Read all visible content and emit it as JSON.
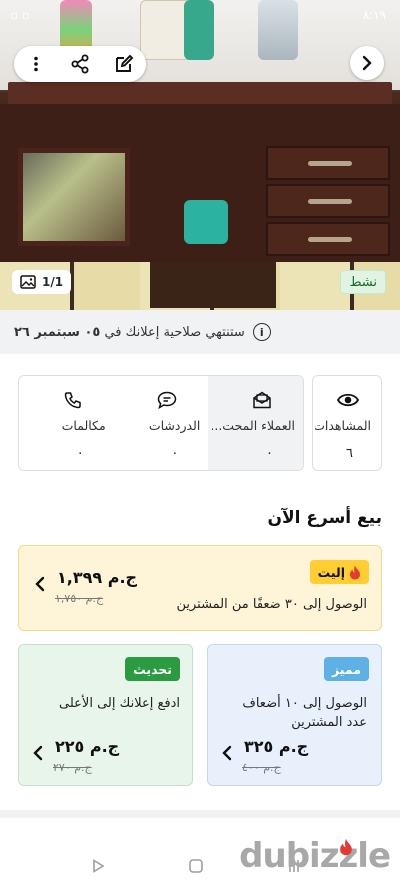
{
  "status_bar": {
    "time": "٨:١٩",
    "left_indicators": "▫ ▫"
  },
  "photo": {
    "counter": "1/1",
    "status_label": "نشط",
    "icons": {
      "back": "chevron-right-icon",
      "share": "share-icon",
      "edit": "edit-icon",
      "more": "more-vertical-icon",
      "gallery": "image-icon"
    }
  },
  "expiry": {
    "prefix": "ستنتهي صلاحية إعلانك في",
    "date": "٠٥ سبتمبر ٢٦",
    "icon": "info-icon"
  },
  "stats": {
    "views": {
      "label": "المشاهدات",
      "value": "٦",
      "icon": "eye-icon"
    },
    "leads": {
      "label": "العملاء المحت...",
      "value": "٠",
      "icon": "mail-open-icon"
    },
    "chats": {
      "label": "الدردشات",
      "value": "٠",
      "icon": "chat-icon"
    },
    "calls": {
      "label": "مكالمات",
      "value": "٠",
      "icon": "phone-icon"
    }
  },
  "sell_faster": {
    "title": "بيع أسرع الآن"
  },
  "elite": {
    "badge": "إليت",
    "badge_icon": "flame-icon",
    "description": "الوصول إلى ٣٠ ضعفًا من المشترين",
    "price": "ج.م ١,٣٩٩",
    "old_price": "ج.م ١,٧٥٠",
    "color": "#ffce32"
  },
  "featured": {
    "badge": "مميز",
    "description_line1": "الوصول إلى ١٠ أضعاف",
    "description_line2": "عدد المشترين",
    "price": "ج.م ٣٢٥",
    "old_price": "ج.م ٤٠٠",
    "color": "#5db1e4"
  },
  "refresh": {
    "badge": "تحديث",
    "description": "ادفع إعلانك إلى الأعلى",
    "price": "ج.م ٢٢٥",
    "old_price": "ج.م ٢٧٠",
    "color": "#2b9b42"
  },
  "bottom": {
    "logo": "dubizzle"
  }
}
